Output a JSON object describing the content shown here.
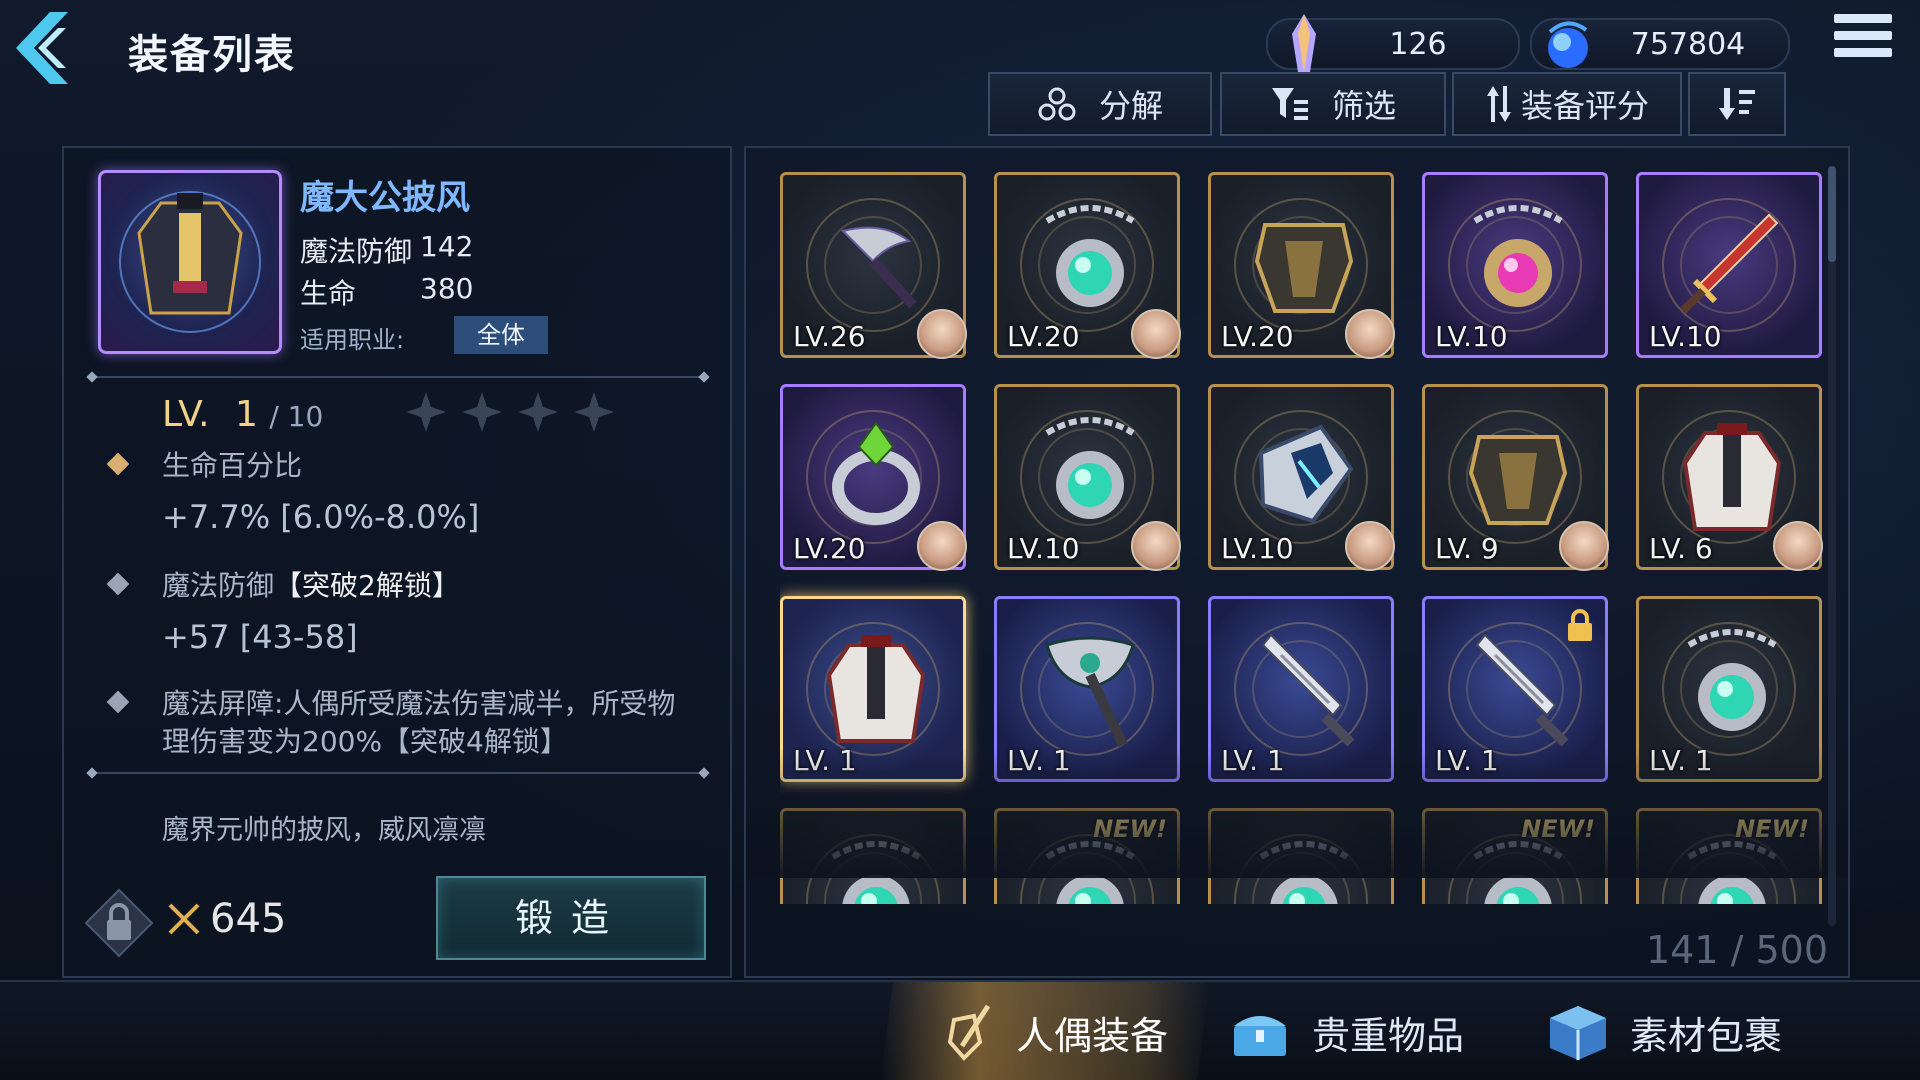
{
  "header": {
    "title": "装备列表",
    "currencies": [
      {
        "icon": "crystal-icon",
        "value": "126"
      },
      {
        "icon": "blue-orb-icon",
        "value": "757804"
      }
    ]
  },
  "toolbar": {
    "decompose_label": "分解",
    "filter_label": "筛选",
    "sort_label": "装备评分"
  },
  "detail": {
    "name": "魔大公披风",
    "stats": [
      {
        "label": "魔法防御",
        "value": "142"
      },
      {
        "label": "生命",
        "value": "380"
      }
    ],
    "class_label": "适用职业:",
    "class_value": "全体",
    "level_prefix": "LV.",
    "level": "1",
    "level_max": "/ 10",
    "stars_total": 4,
    "attributes": [
      {
        "name": "生命百分比",
        "name_lock": "",
        "value": "+7.7% [6.0%-8.0%]",
        "dot_color": "#d8b070"
      },
      {
        "name": "魔法防御",
        "name_lock": "【突破2解锁】",
        "value": "+57 [43-58]",
        "dot_color": "#9aa4b4"
      },
      {
        "name": "魔法屏障:人偶所受魔法伤害减半，所受物",
        "name_lock": "",
        "value": "理伤害变为200%【突破4解锁】",
        "dot_color": "#9aa4b4"
      }
    ],
    "description": "魔界元帅的披风，威风凛凛",
    "power": "645",
    "forge_label": "锻造"
  },
  "grid": {
    "count": "141 / 500",
    "items": [
      {
        "lv": "LV.26",
        "rarity": "gold",
        "icon": "dagger-icon",
        "avatar": true,
        "new": false,
        "locked": false
      },
      {
        "lv": "LV.20",
        "rarity": "gold",
        "icon": "amulet-icon",
        "avatar": true,
        "new": false,
        "locked": false
      },
      {
        "lv": "LV.20",
        "rarity": "gold",
        "icon": "armor-icon",
        "avatar": true,
        "new": false,
        "locked": false
      },
      {
        "lv": "LV.10",
        "rarity": "purple",
        "icon": "pink-amulet-icon",
        "avatar": false,
        "new": false,
        "locked": false
      },
      {
        "lv": "LV.10",
        "rarity": "purple",
        "icon": "sword-icon",
        "avatar": false,
        "new": false,
        "locked": false
      },
      {
        "lv": "LV.20",
        "rarity": "purple",
        "icon": "ring-icon",
        "avatar": true,
        "new": false,
        "locked": false
      },
      {
        "lv": "LV.10",
        "rarity": "gold",
        "icon": "amulet-icon",
        "avatar": true,
        "new": false,
        "locked": false
      },
      {
        "lv": "LV.10",
        "rarity": "gold",
        "icon": "gauntlet-icon",
        "avatar": true,
        "new": false,
        "locked": false
      },
      {
        "lv": "LV. 9",
        "rarity": "gold",
        "icon": "armor-icon",
        "avatar": true,
        "new": false,
        "locked": false
      },
      {
        "lv": "LV. 6",
        "rarity": "gold",
        "icon": "coat-icon",
        "avatar": true,
        "new": false,
        "locked": false
      },
      {
        "lv": "LV. 1",
        "rarity": "selected",
        "icon": "coat-icon",
        "avatar": false,
        "new": false,
        "locked": false
      },
      {
        "lv": "LV. 1",
        "rarity": "blue",
        "icon": "axe-icon",
        "avatar": false,
        "new": false,
        "locked": false
      },
      {
        "lv": "LV. 1",
        "rarity": "blue",
        "icon": "blade-icon",
        "avatar": false,
        "new": false,
        "locked": false
      },
      {
        "lv": "LV. 1",
        "rarity": "blue",
        "icon": "blade-icon",
        "avatar": false,
        "new": false,
        "locked": true
      },
      {
        "lv": "LV. 1",
        "rarity": "gold",
        "icon": "amulet-icon",
        "avatar": false,
        "new": false,
        "locked": false
      },
      {
        "lv": "",
        "rarity": "gold",
        "icon": "amulet-icon",
        "avatar": false,
        "new": false,
        "locked": false
      },
      {
        "lv": "",
        "rarity": "gold",
        "icon": "amulet-icon",
        "avatar": false,
        "new": true,
        "locked": false
      },
      {
        "lv": "",
        "rarity": "gold",
        "icon": "amulet-icon",
        "avatar": false,
        "new": false,
        "locked": false
      },
      {
        "lv": "",
        "rarity": "gold",
        "icon": "amulet-icon",
        "avatar": false,
        "new": true,
        "locked": false
      },
      {
        "lv": "",
        "rarity": "gold",
        "icon": "amulet-icon",
        "avatar": false,
        "new": true,
        "locked": false
      }
    ],
    "new_label": "NEW!"
  },
  "tabs": [
    {
      "label": "人偶装备",
      "icon": "sword-shield-icon",
      "active": true
    },
    {
      "label": "贵重物品",
      "icon": "treasure-chest-icon",
      "active": false
    },
    {
      "label": "素材包裹",
      "icon": "material-box-icon",
      "active": false
    }
  ]
}
